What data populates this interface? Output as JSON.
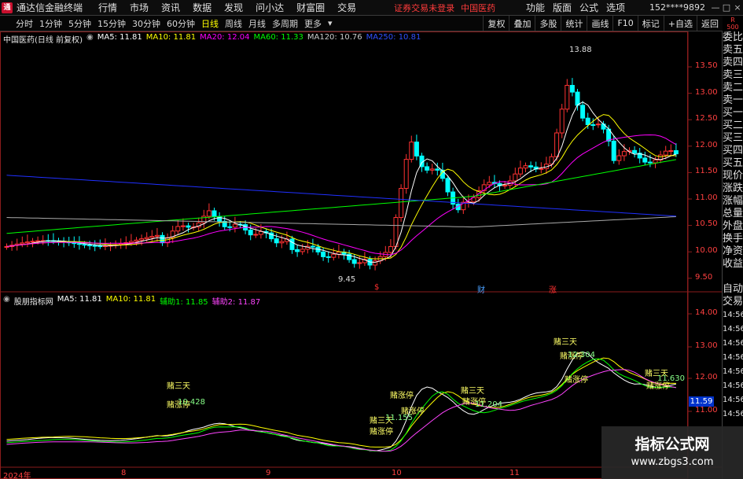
{
  "menubar": {
    "app_title": "通达信金融终端",
    "items": [
      "行情",
      "市场",
      "资讯",
      "数据",
      "发现",
      "问小达",
      "财富圈",
      "交易"
    ],
    "warning": "证券交易未登录",
    "stock_name": "中国医药",
    "right_items": [
      "功能",
      "版面",
      "公式",
      "选项"
    ],
    "user": "152****9892",
    "window_buttons": [
      "—",
      "□",
      "×"
    ]
  },
  "periodbar": {
    "periods": [
      "分时",
      "1分钟",
      "5分钟",
      "15分钟",
      "30分钟",
      "60分钟",
      "日线",
      "周线",
      "月线",
      "多周期",
      "更多"
    ],
    "active": "日线",
    "tools": [
      "复权",
      "叠加",
      "多股",
      "统计",
      "画线",
      "F10",
      "标记",
      "+自选",
      "返回"
    ],
    "rbox": "R\n500"
  },
  "main_legend": {
    "title": "中国医药(日线 前复权)",
    "ma5": "MA5: 11.81",
    "ma10": "MA10: 11.81",
    "ma20": "MA20: 12.04",
    "ma60": "MA60: 11.33",
    "ma120": "MA120: 10.76",
    "ma250": "MA250: 10.81"
  },
  "sub_legend": {
    "title": "股朋指标网",
    "ma5": "MA5: 11.81",
    "ma10": "MA10: 11.81",
    "aux1": "辅助1: 11.85",
    "aux2": "辅助2: 11.87"
  },
  "main_axis": [
    "13.50",
    "13.00",
    "12.50",
    "12.00",
    "11.50",
    "11.00",
    "10.50",
    "10.00",
    "9.50"
  ],
  "sub_axis": [
    "14.00",
    "13.00",
    "12.00",
    "11.00"
  ],
  "price_now": "11.59",
  "date_labels": [
    "2024年",
    "8",
    "9",
    "10",
    "11"
  ],
  "markers": {
    "high": "13.88",
    "low": "9.45",
    "s_mark": "$",
    "cai_mark": "财",
    "zhang_mark": "涨"
  },
  "sidepanel": [
    "委比",
    "卖五",
    "卖四",
    "卖三",
    "卖二",
    "卖一",
    "买一",
    "买二",
    "买三",
    "买四",
    "买五",
    "现价",
    "涨跌",
    "涨幅",
    "总量",
    "外盘",
    "换手",
    "净资",
    "收益",
    "",
    "自动",
    "交易",
    "14:56",
    "14:56",
    "14:56",
    "14:56",
    "14:56",
    "14:56",
    "14:56",
    "14:56"
  ],
  "signals": [
    {
      "text": "赌三天",
      "color": "#ffff66"
    },
    {
      "text": "赌涨停",
      "color": "#ffff66"
    },
    {
      "text": "10.428",
      "color": "#88ff88"
    },
    {
      "text": "11.155",
      "color": "#88ff88"
    },
    {
      "text": "11.204",
      "color": "#88ff88"
    },
    {
      "text": "12.304",
      "color": "#88ff88"
    },
    {
      "text": "11.630",
      "color": "#88ff88"
    }
  ],
  "watermark": {
    "line1": "指标公式网",
    "line2": "www.zbgs3.com"
  },
  "colors": {
    "up": "#ff3232",
    "down": "#00ffff",
    "ma5": "#ffffff",
    "ma10": "#ffff00",
    "ma20": "#ff00ff",
    "ma60": "#00ff00",
    "ma120": "#aaaaaa",
    "ma250": "#2030ff"
  }
}
